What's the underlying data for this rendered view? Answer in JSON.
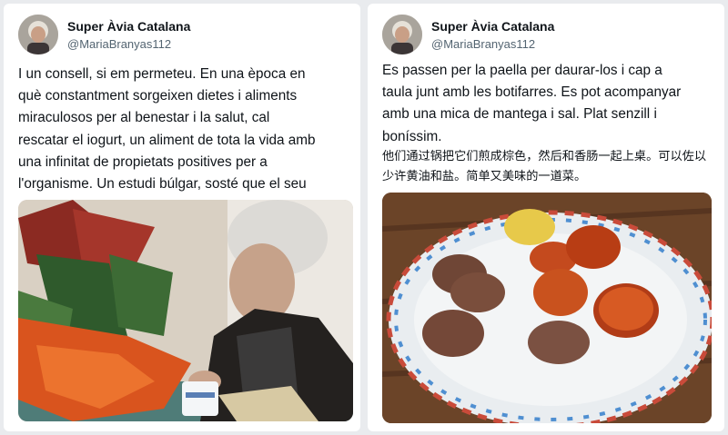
{
  "tweets": [
    {
      "author": "Super Àvia Catalana",
      "handle": "@MariaBranyas112",
      "text": "I un consell, si em permeteu. En una època en\nquè constantment sorgeixen dietes i aliments\nmiraculosos per al benestar i la salut, cal\nrescatar el iogurt, un aliment de tota la vida amb\nuna infinitat de propietats positives per a\nl'organisme. Un estudi búlgar, sosté que el seu"
    },
    {
      "author": "Super Àvia Catalana",
      "handle": "@MariaBranyas112",
      "text": "Es passen per la paella per daurar-los i cap a\ntaula junt amb les botifarres. Es pot acompanyar\namb una mica de mantega i sal. Plat senzill i\nboníssim.",
      "translation": "他们通过锅把它们煎成棕色，然后和香肠一起上桌。可以佐以少许黄油和盐。简单又美味的一道菜。"
    }
  ]
}
